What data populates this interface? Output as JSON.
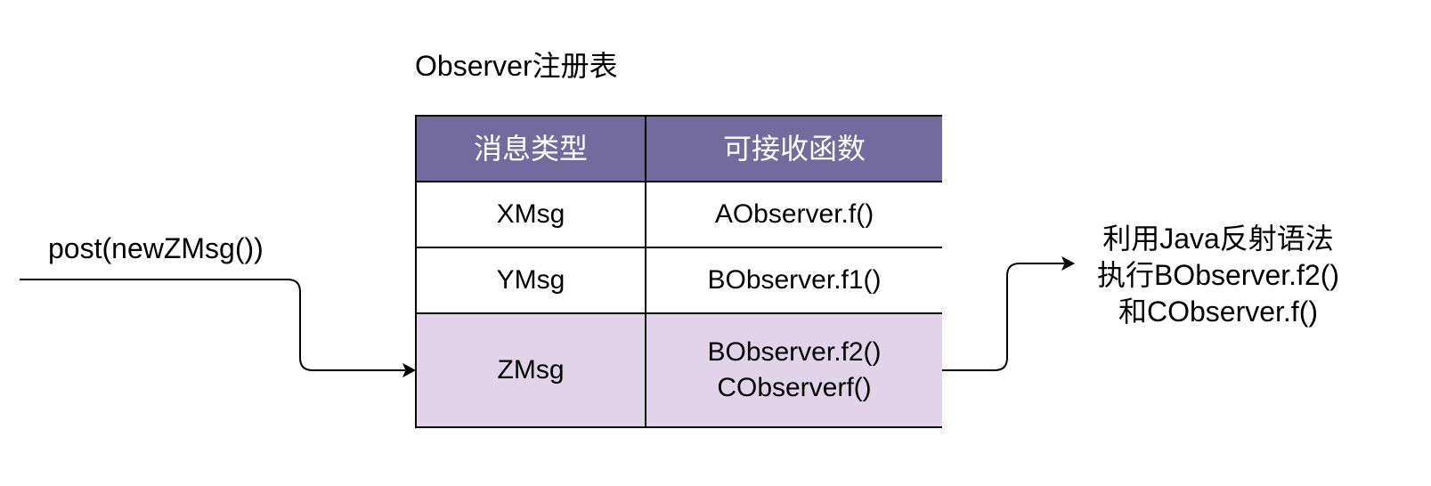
{
  "caption": "Observer注册表",
  "call_label": "post(newZMsg())",
  "result_label": {
    "lines": [
      "利用Java反射语法",
      "执行BObserver.f2()",
      "和CObserver.f()"
    ]
  },
  "colors": {
    "header_fill": "#736a9e",
    "header_text": "#ffffff",
    "highlight_fill": "#e1d3e8",
    "plain_fill": "#ffffff",
    "line": "#000000"
  },
  "table": {
    "headers": [
      "消息类型",
      "可接收函数"
    ],
    "rows": [
      {
        "type": "XMsg",
        "functions": [
          "AObserver.f()"
        ],
        "highlighted": false
      },
      {
        "type": "YMsg",
        "functions": [
          "BObserver.f1()"
        ],
        "highlighted": false
      },
      {
        "type": "ZMsg",
        "functions": [
          "BObserver.f2()",
          "CObserverf()"
        ],
        "highlighted": true
      }
    ]
  }
}
